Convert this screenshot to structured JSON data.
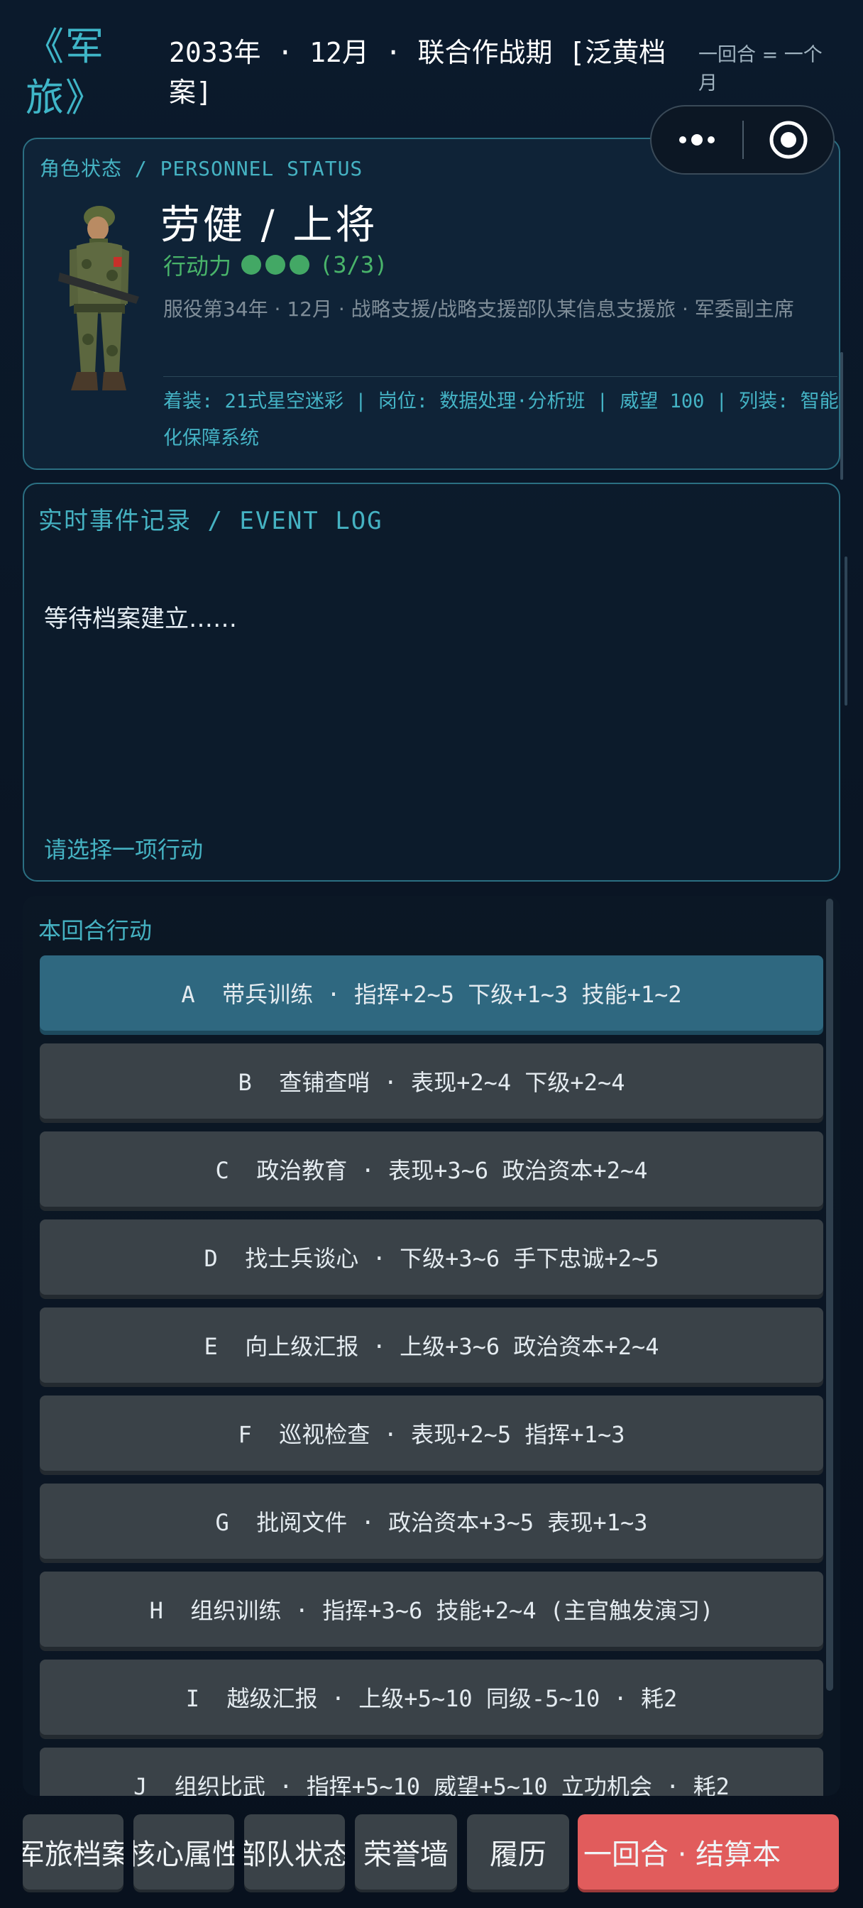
{
  "header": {
    "logo": "《军旅》",
    "period": "2033年 · 12月 · 联合作战期 [泛黄档案]",
    "turn_note": "一回合 = 一个月"
  },
  "status": {
    "label": "角色状态 / PERSONNEL STATUS",
    "name": "劳健  /  上将",
    "ap_label": "行动力",
    "ap_filled": 3,
    "ap_count": "(3/3)",
    "service": "服役第34年 · 12月 · 战略支援/战略支援部队某信息支援旅 · 军委副主席",
    "equip": "着装: 21式星空迷彩 | 岗位: 数据处理·分析班 | 威望 100 | 列装: 智能化保障系统"
  },
  "log": {
    "title": "实时事件记录 / EVENT LOG",
    "text": "等待档案建立……",
    "hint": "请选择一项行动"
  },
  "actions": {
    "title": "本回合行动",
    "items": [
      {
        "label": "A  带兵训练 · 指挥+2~5 下级+1~3 技能+1~2"
      },
      {
        "label": "B  查铺查哨 · 表现+2~4 下级+2~4"
      },
      {
        "label": "C  政治教育 · 表现+3~6 政治资本+2~4"
      },
      {
        "label": "D  找士兵谈心 · 下级+3~6 手下忠诚+2~5"
      },
      {
        "label": "E  向上级汇报 · 上级+3~6 政治资本+2~4"
      },
      {
        "label": "F  巡视检查 · 表现+2~5 指挥+1~3"
      },
      {
        "label": "G  批阅文件 · 政治资本+3~5 表现+1~3"
      },
      {
        "label": "H  组织训练 · 指挥+3~6 技能+2~4 (主官触发演习)"
      },
      {
        "label": "I  越级汇报 · 上级+5~10 同级-5~10 · 耗2"
      },
      {
        "label": "J  组织比武 · 指挥+5~10 威望+5~10 立功机会 · 耗2"
      }
    ]
  },
  "nav": {
    "archive": "军旅档案",
    "core": "核心属性",
    "unit": "部队状态",
    "honor": "荣誉墙",
    "resume": "履历",
    "next": "一回合 · 结算本"
  }
}
